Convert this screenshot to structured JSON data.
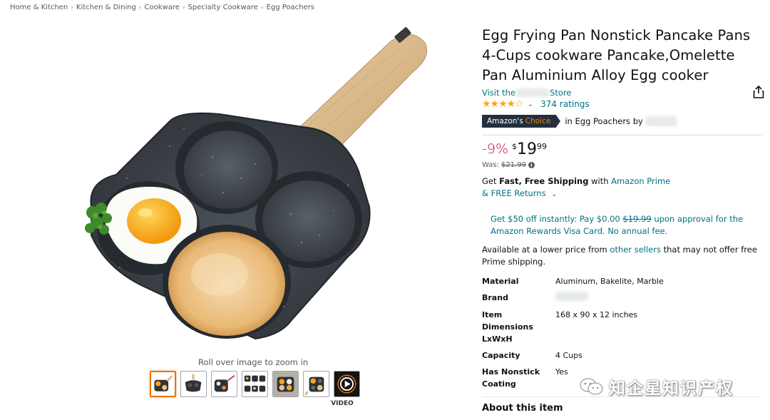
{
  "breadcrumb": [
    "Home & Kitchen",
    "Kitchen & Dining",
    "Cookware",
    "Specialty Cookware",
    "Egg Poachers"
  ],
  "breadcrumb_separator": "›",
  "image": {
    "zoom_hint": "Roll over image to zoom in"
  },
  "thumbnails": {
    "count": 7,
    "selected_index": 0,
    "video_label": "VIDEO"
  },
  "product": {
    "title": "Egg Frying Pan Nonstick Pancake Pans 4-Cups cookware Pancake,Omelette Pan Aluminium Alloy Egg cooker",
    "store_prefix": "Visit the",
    "store_suffix": "Store",
    "rating_stars": "★★★★☆",
    "rating_value": 4.2,
    "ratings_count": "374 ratings",
    "badge": {
      "prefix": "Amazon's",
      "choice": "Choice"
    },
    "badge_context": "in Egg Poachers by"
  },
  "price": {
    "discount": "-9%",
    "currency": "$",
    "whole": "19",
    "fraction": "99",
    "was_label": "Was:",
    "was_price": "$21.99"
  },
  "shipping": {
    "get": "Get",
    "fast": "Fast, Free Shipping",
    "with": "with",
    "prime": "Amazon Prime",
    "returns": "& FREE Returns"
  },
  "promo": {
    "part1": "Get $50 off instantly: Pay $0.00",
    "strike": "$19.99",
    "part2": "upon approval for the Amazon Rewards Visa Card. No annual fee."
  },
  "lower_price": {
    "part1": "Available at a lower price from",
    "link": "other sellers",
    "part2": "that may not offer free Prime shipping."
  },
  "specs": [
    {
      "key": "Material",
      "value": "Aluminum, Bakelite, Marble"
    },
    {
      "key": "Brand",
      "value": ""
    },
    {
      "key": "Item Dimensions LxWxH",
      "value": "168 x 90 x 12 inches"
    },
    {
      "key": "Capacity",
      "value": "4 Cups"
    },
    {
      "key": "Has Nonstick Coating",
      "value": "Yes"
    }
  ],
  "about": "About this item",
  "watermark": "知企星知识产权",
  "colors": {
    "link": "#007185",
    "discount": "#cc0c39",
    "star": "#ffa41c",
    "badge_bg": "#232f3e",
    "badge_accent": "#f08804",
    "thumb_selected": "#e77600"
  }
}
